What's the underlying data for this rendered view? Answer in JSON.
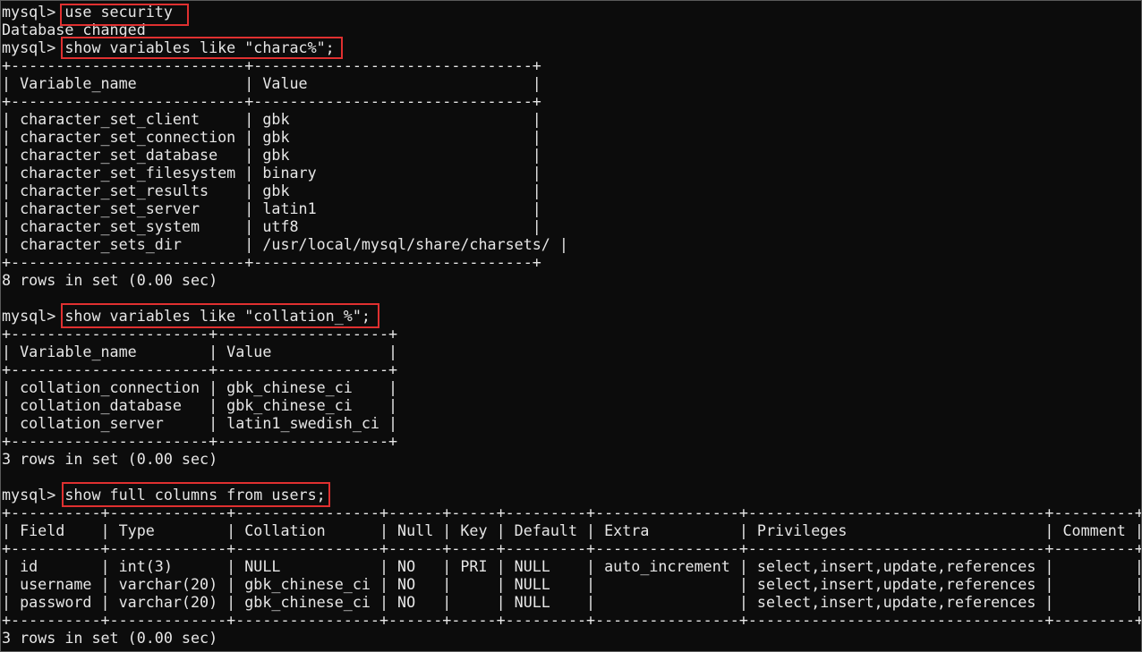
{
  "terminal": {
    "lines": [
      "mysql> use security",
      "Database changed",
      "mysql> show variables like \"charac%\";",
      "+--------------------------+-------------------------------+",
      "| Variable_name            | Value                         |",
      "+--------------------------+-------------------------------+",
      "| character_set_client     | gbk                           |",
      "| character_set_connection | gbk                           |",
      "| character_set_database   | gbk                           |",
      "| character_set_filesystem | binary                        |",
      "| character_set_results    | gbk                           |",
      "| character_set_server     | latin1                        |",
      "| character_set_system     | utf8                          |",
      "| character_sets_dir       | /usr/local/mysql/share/charsets/ |",
      "+--------------------------+-------------------------------+",
      "8 rows in set (0.00 sec)",
      "",
      "mysql> show variables like \"collation_%\";",
      "+----------------------+-------------------+",
      "| Variable_name        | Value             |",
      "+----------------------+-------------------+",
      "| collation_connection | gbk_chinese_ci    |",
      "| collation_database   | gbk_chinese_ci    |",
      "| collation_server     | latin1_swedish_ci |",
      "+----------------------+-------------------+",
      "3 rows in set (0.00 sec)",
      "",
      "mysql> show full columns from users;",
      "+----------+-------------+----------------+------+-----+---------+----------------+---------------------------------+---------+",
      "| Field    | Type        | Collation      | Null | Key | Default | Extra          | Privileges                      | Comment |",
      "+----------+-------------+----------------+------+-----+---------+----------------+---------------------------------+---------+",
      "| id       | int(3)      | NULL           | NO   | PRI | NULL    | auto_increment | select,insert,update,references |         |",
      "| username | varchar(20) | gbk_chinese_ci | NO   |     | NULL    |                | select,insert,update,references |         |",
      "| password | varchar(20) | gbk_chinese_ci | NO   |     | NULL    |                | select,insert,update,references |         |",
      "+----------+-------------+----------------+------+-----+---------+----------------+---------------------------------+---------+",
      "3 rows in set (0.00 sec)"
    ]
  },
  "colors": {
    "background": "#0c0c0c",
    "text": "#e6e6e6",
    "highlight_box": "#e03030"
  }
}
